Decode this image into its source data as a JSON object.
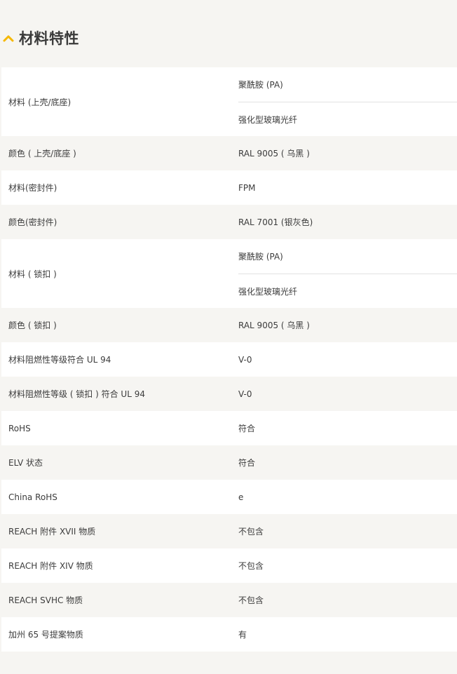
{
  "section": {
    "title": "材料特性",
    "icon": "chevron-up-icon",
    "accent_color": "#f5b800"
  },
  "rows": [
    {
      "label": "材料 (上壳/底座)",
      "values": [
        "聚酰胺 (PA)",
        "强化型玻璃光纤"
      ]
    },
    {
      "label": "颜色 ( 上壳/底座 )",
      "values": [
        "RAL 9005 ( 乌黑 )"
      ]
    },
    {
      "label": "材料(密封件)",
      "values": [
        "FPM"
      ]
    },
    {
      "label": "颜色(密封件)",
      "values": [
        "RAL 7001 (银灰色)"
      ]
    },
    {
      "label": "材料 ( 锁扣 )",
      "values": [
        "聚酰胺 (PA)",
        "强化型玻璃光纤"
      ]
    },
    {
      "label": "颜色 ( 锁扣 )",
      "values": [
        "RAL 9005 ( 乌黑 )"
      ]
    },
    {
      "label": "材料阻燃性等级符合 UL 94",
      "values": [
        "V-0"
      ]
    },
    {
      "label": "材料阻燃性等级 ( 锁扣 ) 符合 UL 94",
      "values": [
        "V-0"
      ]
    },
    {
      "label": "RoHS",
      "values": [
        "符合"
      ]
    },
    {
      "label": "ELV 状态",
      "values": [
        "符合"
      ]
    },
    {
      "label": "China RoHS",
      "values": [
        "e"
      ]
    },
    {
      "label": "REACH 附件 XVII 物质",
      "values": [
        "不包含"
      ]
    },
    {
      "label": "REACH 附件 XIV 物质",
      "values": [
        "不包含"
      ]
    },
    {
      "label": "REACH SVHC 物质",
      "values": [
        "不包含"
      ]
    },
    {
      "label": "加州 65 号提案物质",
      "values": [
        "有"
      ]
    }
  ]
}
